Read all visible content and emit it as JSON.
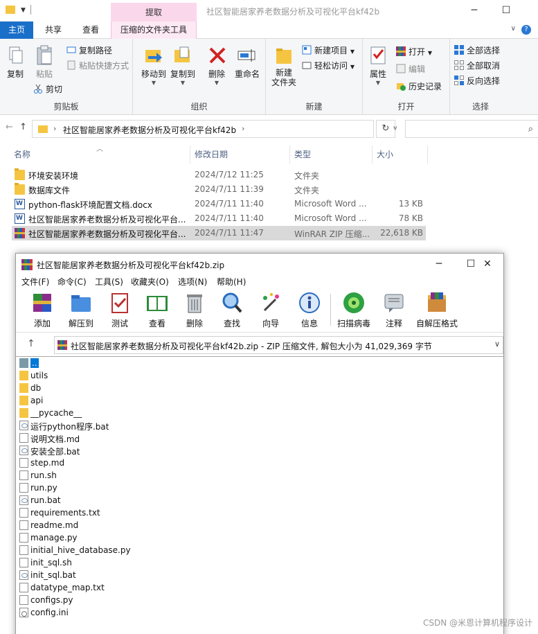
{
  "explorer": {
    "window_title": "社区智能居家养老数据分析及可视化平台kf42b",
    "context_tab_header": "提取",
    "tabs": [
      "主页",
      "共享",
      "查看",
      "压缩的文件夹工具"
    ],
    "ribbon": {
      "clipboard": {
        "label": "剪贴板",
        "copy": "复制",
        "paste": "粘贴",
        "copy_path": "复制路径",
        "paste_shortcut": "粘贴快捷方式",
        "cut": "剪切"
      },
      "organize": {
        "label": "组织",
        "move_to": "移动到",
        "copy_to": "复制到",
        "delete": "删除",
        "rename": "重命名"
      },
      "new": {
        "label": "新建",
        "new_folder": "新建\n文件夹",
        "new_item": "新建项目",
        "easy_access": "轻松访问"
      },
      "open": {
        "label": "打开",
        "properties": "属性",
        "open": "打开",
        "edit": "编辑",
        "history": "历史记录"
      },
      "select": {
        "label": "选择",
        "select_all": "全部选择",
        "select_none": "全部取消",
        "invert": "反向选择"
      }
    },
    "address": {
      "path": "社区智能居家养老数据分析及可视化平台kf42b"
    },
    "columns": {
      "name": "名称",
      "date": "修改日期",
      "type": "类型",
      "size": "大小"
    },
    "files": [
      {
        "icon": "folder-icon",
        "name": "环境安装环境",
        "date": "2024/7/12 11:25",
        "type": "文件夹",
        "size": ""
      },
      {
        "icon": "folder-icon",
        "name": "数据库文件",
        "date": "2024/7/11 11:39",
        "type": "文件夹",
        "size": ""
      },
      {
        "icon": "word-doc-icon",
        "name": "python-flask环境配置文档.docx",
        "date": "2024/7/11 11:40",
        "type": "Microsoft Word ...",
        "size": "13 KB"
      },
      {
        "icon": "word-doc-icon",
        "name": "社区智能居家养老数据分析及可视化平台...",
        "date": "2024/7/11 11:40",
        "type": "Microsoft Word ...",
        "size": "78 KB"
      },
      {
        "icon": "rar-archive-icon",
        "name": "社区智能居家养老数据分析及可视化平台...",
        "date": "2024/7/11 11:47",
        "type": "WinRAR ZIP 压缩...",
        "size": "22,618 KB"
      }
    ]
  },
  "winrar": {
    "title": "社区智能居家养老数据分析及可视化平台kf42b.zip",
    "menu": [
      "文件(F)",
      "命令(C)",
      "工具(S)",
      "收藏夹(O)",
      "选项(N)",
      "帮助(H)"
    ],
    "toolbar": [
      "添加",
      "解压到",
      "测试",
      "查看",
      "删除",
      "查找",
      "向导",
      "信息",
      "扫描病毒",
      "注释",
      "自解压格式"
    ],
    "path_text": "社区智能居家养老数据分析及可视化平台kf42b.zip - ZIP 压缩文件, 解包大小为 41,029,369 字节",
    "items": [
      {
        "icon": "up-icon",
        "name": ".."
      },
      {
        "icon": "folder-icon",
        "name": "utils"
      },
      {
        "icon": "folder-icon",
        "name": "db"
      },
      {
        "icon": "folder-icon",
        "name": "api"
      },
      {
        "icon": "folder-icon",
        "name": "__pycache__"
      },
      {
        "icon": "bat-icon",
        "name": "运行python程序.bat"
      },
      {
        "icon": "file-icon",
        "name": "说明文档.md"
      },
      {
        "icon": "bat-icon",
        "name": "安装全部.bat"
      },
      {
        "icon": "file-icon",
        "name": "step.md"
      },
      {
        "icon": "file-icon",
        "name": "run.sh"
      },
      {
        "icon": "file-icon",
        "name": "run.py"
      },
      {
        "icon": "bat-icon",
        "name": "run.bat"
      },
      {
        "icon": "file-icon",
        "name": "requirements.txt"
      },
      {
        "icon": "file-icon",
        "name": "readme.md"
      },
      {
        "icon": "file-icon",
        "name": "manage.py"
      },
      {
        "icon": "file-icon",
        "name": "initial_hive_database.py"
      },
      {
        "icon": "file-icon",
        "name": "init_sql.sh"
      },
      {
        "icon": "bat-icon",
        "name": "init_sql.bat"
      },
      {
        "icon": "file-icon",
        "name": "datatype_map.txt"
      },
      {
        "icon": "file-icon",
        "name": "configs.py"
      },
      {
        "icon": "ini-icon",
        "name": "config.ini"
      }
    ]
  },
  "watermark": "CSDN @米恩计算机程序设计"
}
